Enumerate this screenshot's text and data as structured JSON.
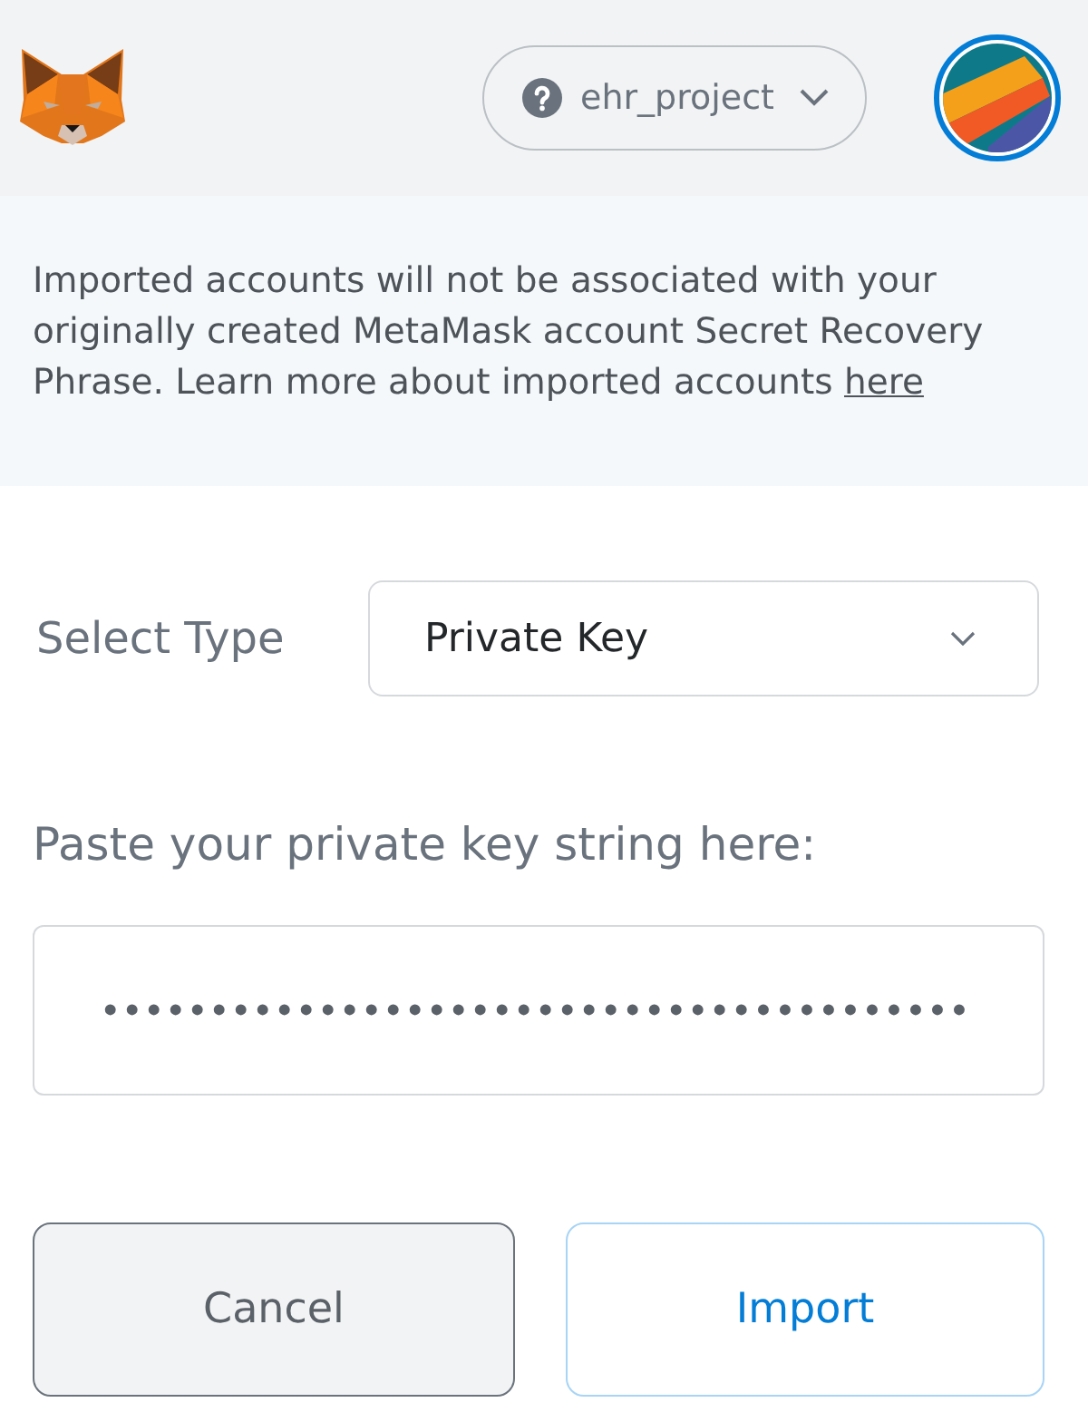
{
  "header": {
    "network": {
      "name": "ehr_project"
    }
  },
  "notice": {
    "text": "Imported accounts will not be associated with your originally created MetaMask account Secret Recovery Phrase. Learn more about imported accounts",
    "link": "here"
  },
  "select_type": {
    "label": "Select Type",
    "value": "Private Key"
  },
  "private_key": {
    "label": "Paste your private key string here:",
    "value": "••••••••••••••••••••••••••••••••••••••••"
  },
  "buttons": [
    {
      "label": "Cancel",
      "kind": "secondary"
    },
    {
      "label": "Import",
      "kind": "primary"
    }
  ]
}
